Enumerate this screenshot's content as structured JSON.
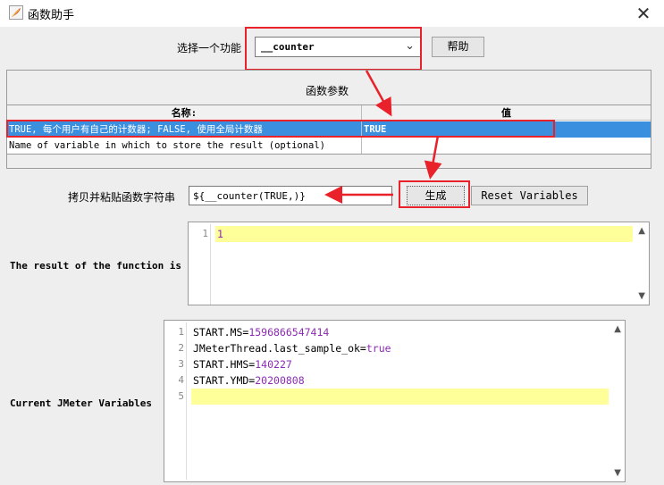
{
  "window": {
    "title": "函数助手",
    "close_glyph": "✕"
  },
  "function_select": {
    "label": "选择一个功能",
    "value": "__counter",
    "help_label": "帮助"
  },
  "params": {
    "section_label": "函数参数",
    "col_name": "名称:",
    "col_value": "值",
    "rows": [
      {
        "name": "TRUE, 每个用户有自己的计数器; FALSE, 使用全局计数器",
        "value": "TRUE"
      },
      {
        "name": "Name of variable in which to store the result (optional)",
        "value": ""
      }
    ]
  },
  "copy": {
    "label": "拷贝并粘贴函数字符串",
    "value": "${__counter(TRUE,)}",
    "generate_label": "生成",
    "reset_label": "Reset Variables"
  },
  "result": {
    "label": "The result of the function is",
    "lines": [
      {
        "num": "1",
        "text": "1"
      }
    ]
  },
  "vars": {
    "label": "Current JMeter Variables",
    "lines": [
      {
        "num": "1",
        "key": "START.MS=",
        "val": "1596866547414"
      },
      {
        "num": "2",
        "key": "JMeterThread.last_sample_ok=",
        "val": "true"
      },
      {
        "num": "3",
        "key": "START.HMS=",
        "val": "140227"
      },
      {
        "num": "4",
        "key": "START.YMD=",
        "val": "20200808"
      },
      {
        "num": "5",
        "key": "",
        "val": ""
      }
    ]
  },
  "colors": {
    "selection": "#3b8fdf",
    "highlight": "#e8212a",
    "value_purple": "#8b2bb3",
    "current_line": "#ffff99"
  },
  "icons": {
    "app": "jmeter-feather-icon",
    "dropdown": "chevron-down-icon",
    "scroll_up": "scroll-up-icon",
    "scroll_down": "scroll-down-icon"
  }
}
